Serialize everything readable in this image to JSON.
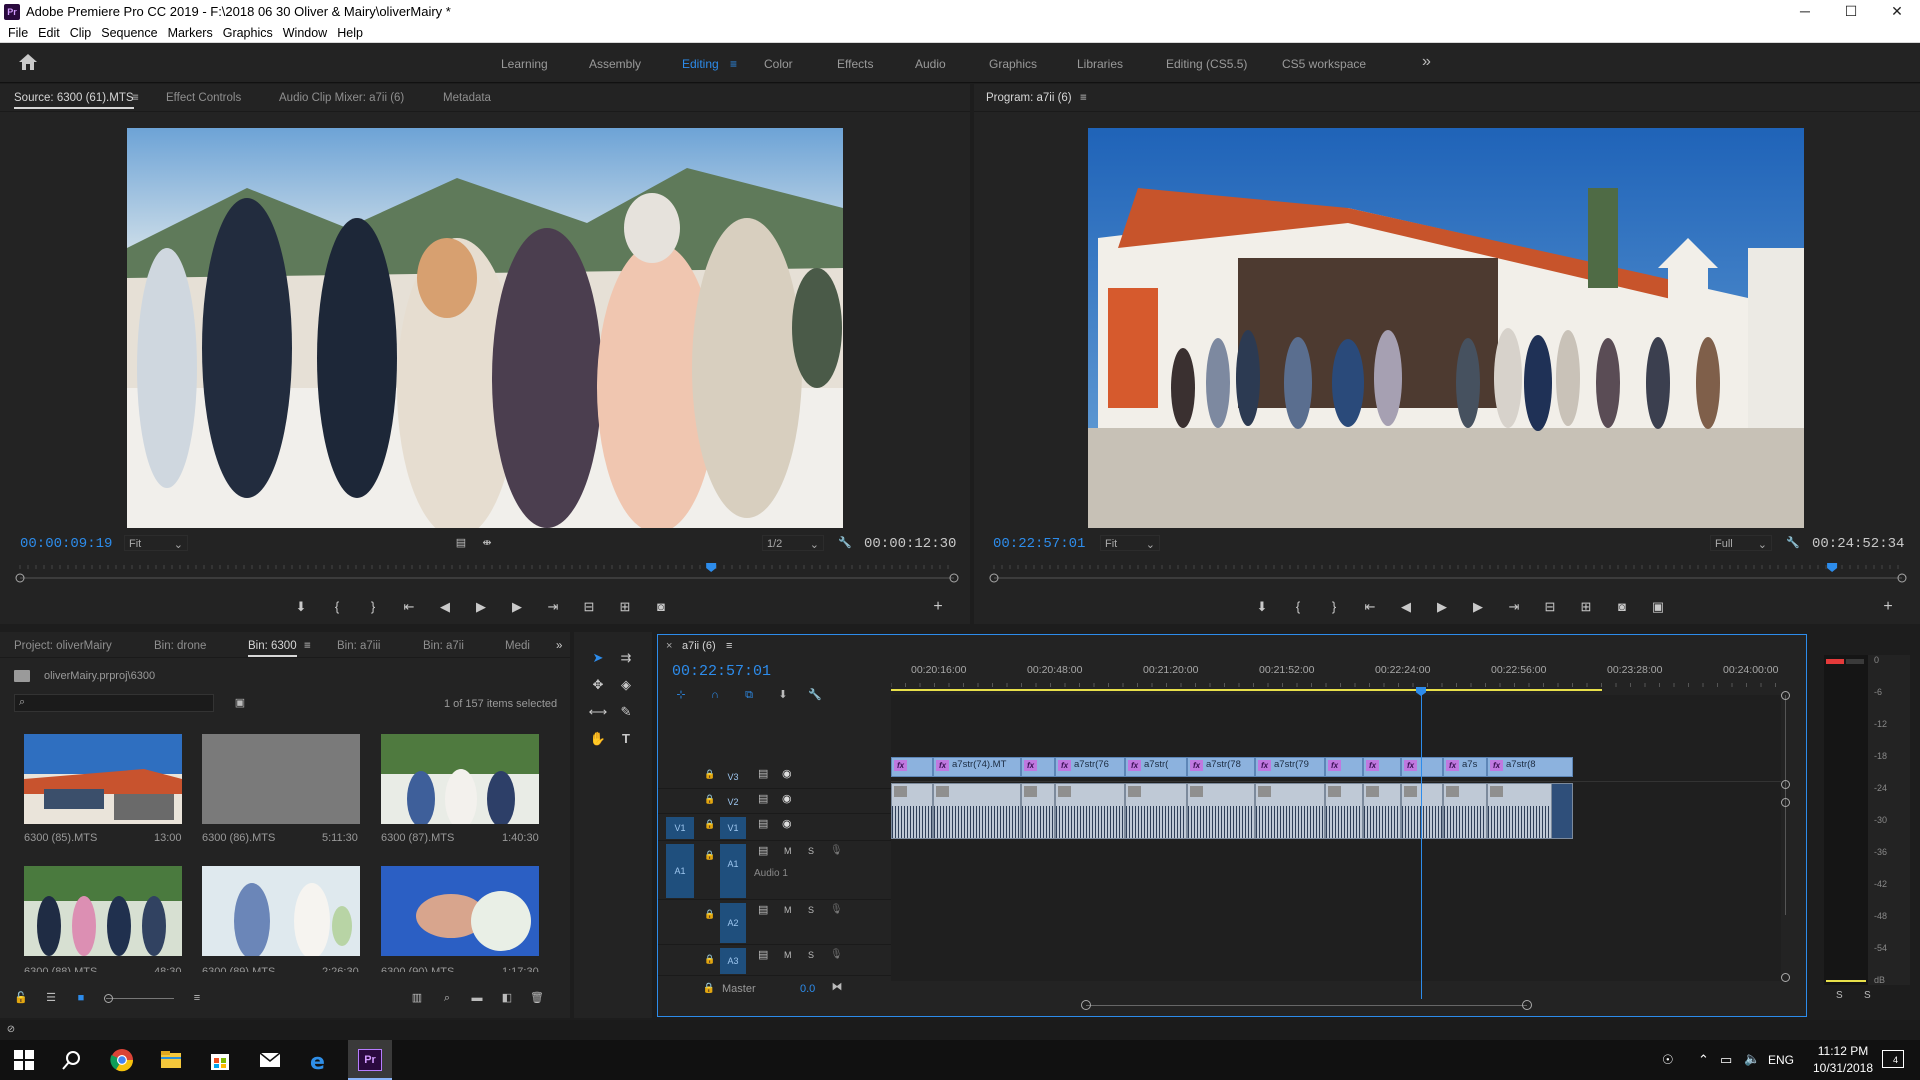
{
  "window": {
    "title": "Adobe Premiere Pro CC 2019 - F:\\2018 06 30 Oliver & Mairy\\oliverMairy *",
    "app_icon": "Pr",
    "controls": {
      "minimize": "─",
      "maximize": "☐",
      "close": "✕"
    }
  },
  "menu": [
    "File",
    "Edit",
    "Clip",
    "Sequence",
    "Markers",
    "Graphics",
    "Window",
    "Help"
  ],
  "workspaces": [
    "Learning",
    "Assembly",
    "Editing",
    "Color",
    "Effects",
    "Audio",
    "Graphics",
    "Libraries",
    "Editing (CS5.5)",
    "CS5 workspace"
  ],
  "workspaces_active": "Editing",
  "workspaces_more": "»",
  "source": {
    "tabs": [
      "Source: 6300 (61).MTS",
      "Effect Controls",
      "Audio Clip Mixer: a7ii (6)",
      "Metadata"
    ],
    "menu_icon": "≡",
    "timecode": "00:00:09:19",
    "fit": "Fit",
    "resolution": "1/2",
    "duration": "00:00:12:30",
    "playhead_fraction": 0.74
  },
  "program": {
    "tab": "Program: a7ii (6)",
    "menu_icon": "≡",
    "timecode": "00:22:57:01",
    "fit": "Fit",
    "resolution": "Full",
    "duration": "00:24:52:34",
    "playhead_fraction": 0.923
  },
  "transport_glyphs": {
    "marker": "⬇",
    "in": "{",
    "out": "}",
    "goto_in": "⇤",
    "step_back": "◀",
    "play": "▶",
    "step_fwd": "▶",
    "goto_out": "⇥",
    "insert": "⊟",
    "overwrite": "⊞",
    "camera": "◙",
    "compare": "▣",
    "add": "+"
  },
  "project": {
    "tabs": [
      "Project: oliverMairy",
      "Bin: drone",
      "Bin: 6300",
      "Bin: a7iii",
      "Bin: a7ii",
      "Medi"
    ],
    "active_tab": "Bin: 6300",
    "more": "»",
    "path": "oliverMairy.prproj\\6300",
    "search_placeholder": "",
    "selection_info": "1 of 157 items selected",
    "items": [
      {
        "name": "6300 (85).MTS",
        "duration": "13:00"
      },
      {
        "name": "6300 (86).MTS",
        "duration": "5:11:30"
      },
      {
        "name": "6300 (87).MTS",
        "duration": "1:40:30"
      },
      {
        "name": "6300 (88).MTS",
        "duration": "48:30"
      },
      {
        "name": "6300 (89).MTS",
        "duration": "2:26:30"
      },
      {
        "name": "6300 (90).MTS",
        "duration": "1:17:30"
      }
    ]
  },
  "timeline": {
    "tab": "a7ii (6)",
    "close": "×",
    "menu_icon": "≡",
    "timecode": "00:22:57:01",
    "ruler": [
      "00:20:16:00",
      "00:20:48:00",
      "00:21:20:00",
      "00:21:52:00",
      "00:22:24:00",
      "00:22:56:00",
      "00:23:28:00",
      "00:24:00:00"
    ],
    "tracks_video": [
      "V3",
      "V2",
      "V1"
    ],
    "tracks_audio": [
      "A1",
      "A2",
      "A3"
    ],
    "src_video": "V1",
    "src_audio": "A1",
    "audio_name": "Audio 1",
    "master": "Master",
    "master_value": "0.0",
    "clip_fx": "fx",
    "clips": [
      "",
      "a7str(74).MT",
      "",
      "a7str(76",
      "a7str(",
      "a7str(78",
      "a7str(79",
      "",
      "",
      "",
      "a7s",
      "a7str(8"
    ],
    "track_buttons": {
      "m": "M",
      "s": "S"
    }
  },
  "meter": {
    "scale": [
      "0",
      "-6",
      "-12",
      "-18",
      "-24",
      "-30",
      "-36",
      "-42",
      "-48",
      "-54",
      "dB"
    ],
    "solo": [
      "S",
      "S"
    ]
  },
  "taskbar": {
    "lang": "ENG",
    "time": "11:12 PM",
    "date": "10/31/2018",
    "notif": "4"
  },
  "colors": {
    "accent": "#2d8ceb",
    "clip_video": "#8cb2de",
    "clip_audio": "#bfc9d6",
    "fx": "#c078e0",
    "work_area": "#e8e04a",
    "premiere_purple": "#2a0a3e"
  }
}
